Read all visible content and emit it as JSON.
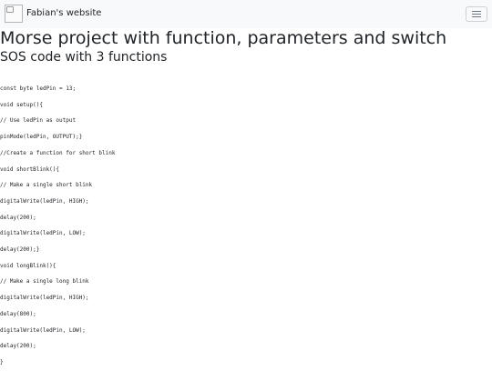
{
  "navbar": {
    "brand_icon": "broken-image-icon",
    "brand_text": "Fabian's website",
    "toggler_icon": "hamburger-menu-icon"
  },
  "main": {
    "title": "Morse project with function, parameters and switch",
    "subtitle": "SOS code with 3 functions",
    "code_lines": [
      "const byte ledPin = 13;",
      "void setup(){",
      "// Use ledPin as output",
      "pinMode(ledPin, OUTPUT);}",
      "//Create a function for short blink",
      "void shortBlink(){",
      "// Make a single short blink",
      "digitalWrite(ledPin, HIGH);",
      "delay(200);",
      "digitalWrite(ledPin, LOW);",
      "delay(200);}",
      "void longBlink(){",
      "// Make a single long blink",
      "digitalWrite(ledPin, HIGH);",
      "delay(800);",
      "digitalWrite(ledPin, LOW);",
      "delay(200);",
      "}"
    ]
  }
}
